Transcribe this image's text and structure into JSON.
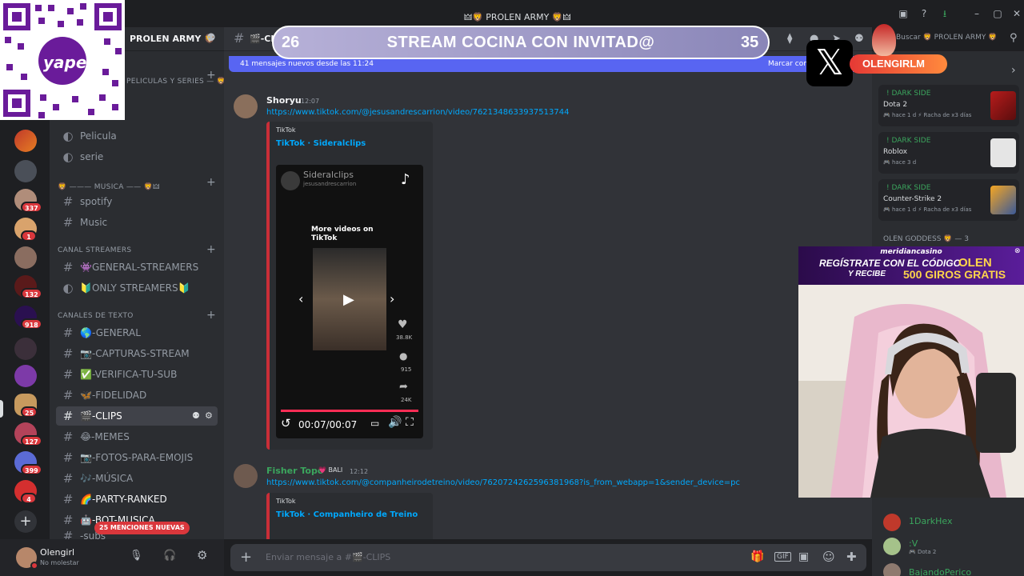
{
  "window": {
    "title": "🜲🦁 PROLEN ARMY 🦁🜲"
  },
  "server": {
    "name": "PROLEN ARMY 🦁"
  },
  "stream_banner": {
    "left_number": "26",
    "title": "STREAM COCINA CON INVITAD@",
    "right_number": "35"
  },
  "new_messages_bar": {
    "text": "41 mensajes nuevos desde las 11:24",
    "mark_read": "Marcar com"
  },
  "search": {
    "placeholder": "Buscar 🦁 PROLEN ARMY 🦁"
  },
  "overlay": {
    "x_label": "𝕏",
    "handle": "OLENGIRLM",
    "qr_brand": "yape"
  },
  "rail": {
    "badges": [
      "337",
      "1",
      "132",
      "918",
      "25",
      "127",
      "399",
      "4"
    ],
    "add_server": "+"
  },
  "channels": {
    "top_cat": "PELICULAS Y SERIES — 🦁🜲",
    "items_top": [
      {
        "label": "Pelicula",
        "type": "voice"
      },
      {
        "label": "serie",
        "type": "voice"
      }
    ],
    "music_cat": "🦁 ——— MUSICA —— 🦁🜲",
    "music_items": [
      {
        "label": "spotify"
      },
      {
        "label": "Music"
      }
    ],
    "streamers_cat": "CANAL STREAMERS",
    "streamers_items": [
      {
        "label": "👾GENERAL-STREAMERS"
      },
      {
        "label": "🔰ONLY STREAMERS🔰"
      }
    ],
    "text_cat": "CANALES DE TEXTO",
    "text_items": [
      {
        "label": "🌎-GENERAL"
      },
      {
        "label": "📷-CAPTURAS-STREAM"
      },
      {
        "label": "✅-VERIFICA-TU-SUB"
      },
      {
        "label": "🦋-FIDELIDAD"
      },
      {
        "label": "🎬-CLIPS"
      },
      {
        "label": "😂-MEMES"
      },
      {
        "label": "📷-FOTOS-PARA-EMOJIS"
      },
      {
        "label": "🎶-MÚSICA"
      },
      {
        "label": "🌈-PARTY-RANKED"
      },
      {
        "label": "🤖-BOT-MUSICA"
      },
      {
        "label": "-subs"
      }
    ],
    "mentions_pill": "25 MENCIONES NUEVAS"
  },
  "user": {
    "name": "Olengirl",
    "status": "No molestar"
  },
  "header": {
    "channel": "🎬-CLIPS"
  },
  "messages": [
    {
      "author": "Shoryu",
      "time": "12:07",
      "link": "https://www.tiktok.com/@jesusandrescarrion/video/7621348633937513744",
      "embed": {
        "provider": "TikTok",
        "title": "TikTok · Sideralclips",
        "video": {
          "account": "Sideralclips",
          "handle": "jesusandrescarrion",
          "more_videos": "More videos on TikTok",
          "likes": "38.8K",
          "comments": "915",
          "shares": "24K",
          "time": "00:07/00:07",
          "progress": 1.0
        }
      }
    },
    {
      "author": "Fisher Topo",
      "badge": "💗 BALI",
      "time": "12:12",
      "link": "https://www.tiktok.com/@companheirodetreino/video/7620724262596381968?is_from_webapp=1&sender_device=pc",
      "embed": {
        "provider": "TikTok",
        "title": "TikTok · Companheiro de Treino"
      }
    }
  ],
  "composer": {
    "placeholder": "Enviar mensaje a #🎬-CLIPS"
  },
  "activity": [
    {
      "name": "! DARK SIDE",
      "game": "Dota 2",
      "meta": "🎮 hace 1 d  ⚡ Racha de x3 días"
    },
    {
      "name": "! DARK SIDE",
      "game": "Roblox",
      "meta": "🎮 hace 3 d"
    },
    {
      "name": "! DARK SIDE",
      "game": "Counter-Strike 2",
      "meta": "🎮 hace 1 d  ⚡ Racha de x3 días"
    }
  ],
  "members_heading": "OLEN GODDESS 🦁 — 3",
  "members": [
    {
      "name": "1DarkHex",
      "sub": ""
    },
    {
      "name": ":V",
      "sub": "🎮 Dota 2"
    },
    {
      "name": "BajandoPerico",
      "sub": ""
    }
  ],
  "cam_ad": {
    "brand": "meridiancasino",
    "line1": "REGÍSTRATE CON EL CÓDIGO",
    "code": "OLEN",
    "line2": "Y RECIBE",
    "offer": "500 GIROS GRATIS"
  }
}
